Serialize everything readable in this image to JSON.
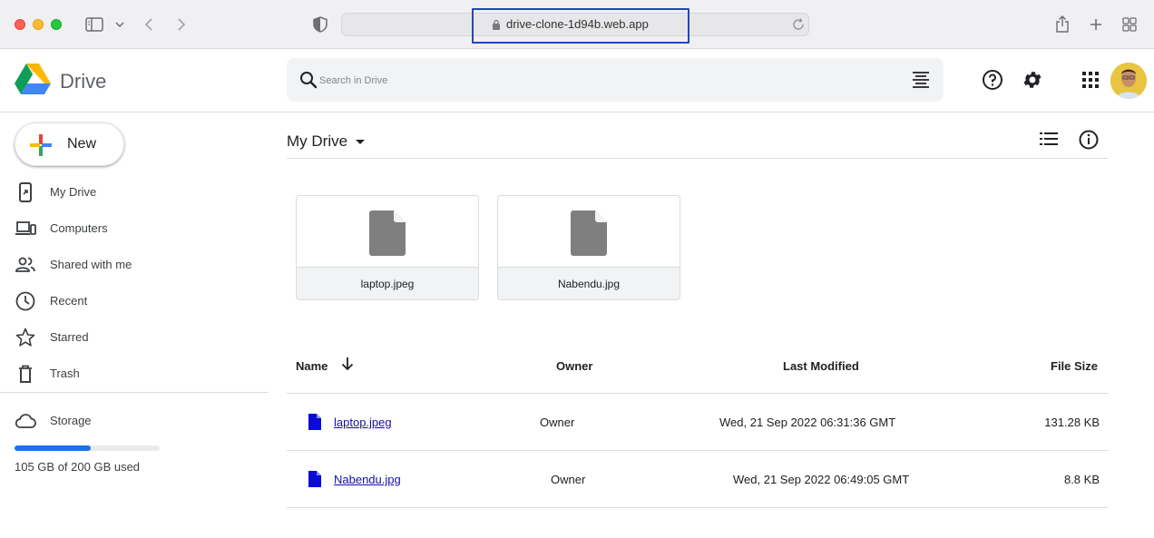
{
  "browser": {
    "url": "drive-clone-1d94b.web.app"
  },
  "header": {
    "brand": "Drive",
    "search_placeholder": "Search in Drive"
  },
  "sidebar": {
    "new_label": "New",
    "items": [
      {
        "label": "My Drive",
        "icon": "my-drive-icon"
      },
      {
        "label": "Computers",
        "icon": "computers-icon"
      },
      {
        "label": "Shared with me",
        "icon": "shared-icon"
      },
      {
        "label": "Recent",
        "icon": "clock-icon"
      },
      {
        "label": "Starred",
        "icon": "star-icon"
      },
      {
        "label": "Trash",
        "icon": "trash-icon"
      }
    ],
    "storage": {
      "label": "Storage",
      "used_text": "105 GB of 200 GB used",
      "used_fraction": 0.525
    }
  },
  "main": {
    "title": "My Drive",
    "suggested": [
      {
        "name": "laptop.jpeg"
      },
      {
        "name": "Nabendu.jpg"
      }
    ],
    "columns": {
      "name": "Name",
      "owner": "Owner",
      "modified": "Last Modified",
      "size": "File Size"
    },
    "rows": [
      {
        "name": "laptop.jpeg",
        "owner": "Owner",
        "modified": "Wed, 21 Sep 2022 06:31:36 GMT",
        "size": "131.28 KB"
      },
      {
        "name": "Nabendu.jpg",
        "owner": "Owner",
        "modified": "Wed, 21 Sep 2022 06:49:05 GMT",
        "size": "8.8 KB"
      }
    ]
  },
  "colors": {
    "accent": "#1a73e8",
    "link": "#1a0dab",
    "file_icon_blue": "#0b0bd6"
  }
}
